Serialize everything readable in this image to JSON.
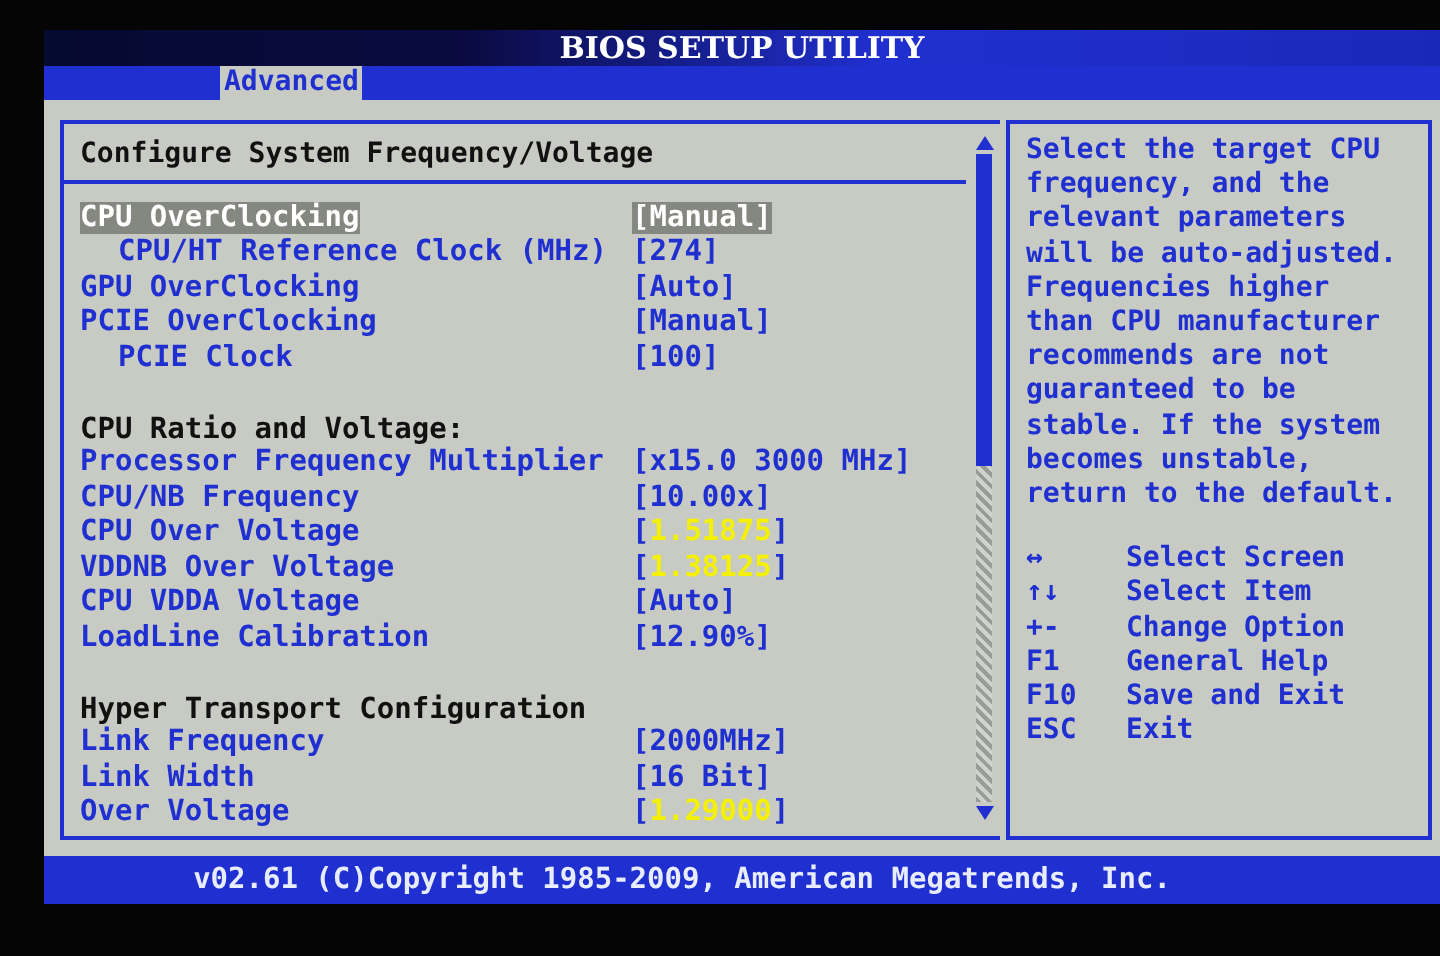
{
  "title": "BIOS SETUP UTILITY",
  "tabs": [
    {
      "label": "Advanced",
      "selected": true
    }
  ],
  "panel": {
    "heading": "Configure System Frequency/Voltage",
    "items": [
      {
        "kind": "setting",
        "label": "CPU OverClocking",
        "value": "[Manual]",
        "selected": true,
        "warning": false,
        "children": [
          {
            "kind": "setting",
            "label": "CPU/HT Reference Clock (MHz)",
            "value": "[274]",
            "selected": false,
            "warning": false
          }
        ]
      },
      {
        "kind": "setting",
        "label": "GPU OverClocking",
        "value": "[Auto]",
        "selected": false,
        "warning": false
      },
      {
        "kind": "setting",
        "label": "PCIE OverClocking",
        "value": "[Manual]",
        "selected": false,
        "warning": false,
        "children": [
          {
            "kind": "setting",
            "label": "PCIE Clock",
            "value": "[100]",
            "selected": false,
            "warning": false
          }
        ]
      },
      {
        "kind": "heading",
        "label": "CPU Ratio and Voltage:"
      },
      {
        "kind": "setting",
        "label": "Processor Frequency Multiplier",
        "value": "[x15.0 3000 MHz]",
        "selected": false,
        "warning": false
      },
      {
        "kind": "setting",
        "label": "CPU/NB Frequency",
        "value": "[10.00x]",
        "selected": false,
        "warning": false
      },
      {
        "kind": "setting",
        "label": "CPU Over Voltage",
        "value": "[1.51875]",
        "selected": false,
        "warning": true
      },
      {
        "kind": "setting",
        "label": "VDDNB Over Voltage",
        "value": "[1.38125]",
        "selected": false,
        "warning": true
      },
      {
        "kind": "setting",
        "label": "CPU VDDA Voltage",
        "value": "[Auto]",
        "selected": false,
        "warning": false
      },
      {
        "kind": "setting",
        "label": "LoadLine Calibration",
        "value": "[12.90%]",
        "selected": false,
        "warning": false
      },
      {
        "kind": "heading",
        "label": "Hyper Transport Configuration"
      },
      {
        "kind": "setting",
        "label": "Link Frequency",
        "value": "[2000MHz]",
        "selected": false,
        "warning": false
      },
      {
        "kind": "setting",
        "label": "Link Width",
        "value": "[16 Bit]",
        "selected": false,
        "warning": false
      },
      {
        "kind": "setting",
        "label": "Over Voltage",
        "value": "[1.29000]",
        "selected": false,
        "warning": true
      }
    ]
  },
  "help": {
    "text": "Select the target CPU frequency, and the relevant parameters will be auto-adjusted. Frequencies higher than CPU manufacturer recommends are not guaranteed to be stable. If the system becomes unstable, return to the default.",
    "keys": [
      {
        "key": "↔",
        "action": "Select Screen"
      },
      {
        "key": "↑↓",
        "action": "Select Item"
      },
      {
        "key": "+-",
        "action": "Change Option"
      },
      {
        "key": "F1",
        "action": "General Help"
      },
      {
        "key": "F10",
        "action": "Save and Exit"
      },
      {
        "key": "ESC",
        "action": "Exit"
      }
    ]
  },
  "footer": "v02.61 (C)Copyright 1985-2009, American Megatrends, Inc."
}
